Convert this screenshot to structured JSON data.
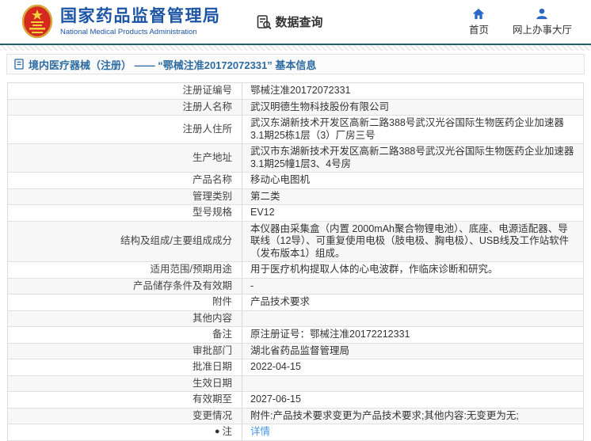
{
  "header": {
    "agency_cn": "国家药品监督管理局",
    "agency_en": "National Medical Products Administration",
    "data_query_label": "数据查询",
    "nav": [
      {
        "label": "首页",
        "icon": "home-icon"
      },
      {
        "label": "网上办事大厅",
        "icon": "user-icon"
      }
    ]
  },
  "breadcrumb": {
    "title": "境内医疗器械（注册） —— “鄂械注准20172072331” 基本信息"
  },
  "table": {
    "rows": [
      {
        "label": "注册证编号",
        "value": "鄂械注准20172072331"
      },
      {
        "label": "注册人名称",
        "value": "武汉明德生物科技股份有限公司"
      },
      {
        "label": "注册人住所",
        "value": "武汉东湖新技术开发区高新二路388号武汉光谷国际生物医药企业加速器3.1期25栋1层（3）厂房三号"
      },
      {
        "label": "生产地址",
        "value": "武汉市东湖新技术开发区高新二路388号武汉光谷国际生物医药企业加速器3.1期25幢1层3、4号房"
      },
      {
        "label": "产品名称",
        "value": "移动心电图机"
      },
      {
        "label": "管理类别",
        "value": "第二类"
      },
      {
        "label": "型号规格",
        "value": "EV12"
      },
      {
        "label": "结构及组成/主要组成成分",
        "value": "本仪器由采集盒（内置 2000mAh聚合物锂电池）、底座、电源适配器、导联线（12导）、可重复使用电极（肢电极、胸电极）、USB线及工作站软件（发布版本1）组成。"
      },
      {
        "label": "适用范围/预期用途",
        "value": "用于医疗机构提取人体的心电波群，作临床诊断和研究。"
      },
      {
        "label": "产品储存条件及有效期",
        "value": "-"
      },
      {
        "label": "附件",
        "value": "产品技术要求"
      },
      {
        "label": "其他内容",
        "value": ""
      },
      {
        "label": "备注",
        "value": "原注册证号：鄂械注准20172212331"
      },
      {
        "label": "审批部门",
        "value": "湖北省药品监督管理局"
      },
      {
        "label": "批准日期",
        "value": "2022-04-15"
      },
      {
        "label": "生效日期",
        "value": ""
      },
      {
        "label": "有效期至",
        "value": "2027-06-15"
      },
      {
        "label": "变更情况",
        "value": "附件:产品技术要求变更为产品技术要求;其他内容:无变更为无;"
      },
      {
        "label": "注",
        "value": "详情",
        "is_link": true,
        "has_note_icon": true
      }
    ]
  },
  "colors": {
    "brand_blue": "#1d55a5",
    "breadcrumb_blue": "#2d6ca2",
    "link_blue": "#4493e4",
    "header_border_teal": "#265d68",
    "row_alt_bg": "#f7f7f7",
    "emblem_red": "#d5281e",
    "emblem_gold": "#e8b53a"
  }
}
